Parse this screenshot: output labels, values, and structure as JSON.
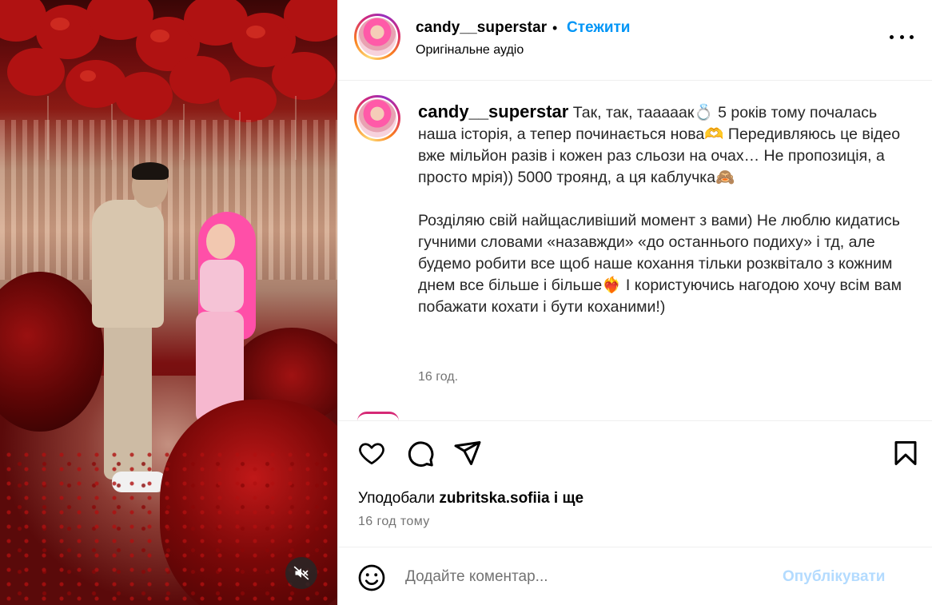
{
  "post": {
    "username": "candy__superstar",
    "follow_label": "Стежити",
    "separator": "•",
    "audio_label": "Оригінальне аудіо"
  },
  "caption": {
    "username": "candy__superstar",
    "text": " Так, так, таааaaк💍 5 років тому почалась наша історія, а тепер починається нова🫶 Передивляюсь це відео вже мільйон разів і кожен раз сльози на очах… Не пропозиція, а просто мрія)) 5000 троянд, а ця каблучка🙈\n\nРозділяю свій найщасливіший момент з вами) Не люблю кидатись гучними словами «назавжди» «до останнього подиху» і тд, але будемо робити все щоб наше кохання тільки розквітало з кожним днем все більше і більше❤️‍🔥 І користуючись нагодою хочу всім вам побажати кохати і бути коханими!)",
    "time": "16 год."
  },
  "likes": {
    "prefix": "Уподобали ",
    "user": "zubritska.sofiia",
    "suffix": " і ще",
    "time": "16 год тому"
  },
  "comment": {
    "placeholder": "Додайте коментар...",
    "publish_label": "Опублікувати"
  },
  "icons": {
    "more": "more-horizontal-icon",
    "like": "heart-icon",
    "comment": "comment-icon",
    "share": "share-icon",
    "save": "bookmark-icon",
    "emoji": "emoji-icon",
    "mute": "sound-off-icon"
  },
  "colors": {
    "accent": "#0095f6",
    "publish_disabled": "#b3dbff",
    "secondary_text": "#737373",
    "divider": "#efefef"
  }
}
